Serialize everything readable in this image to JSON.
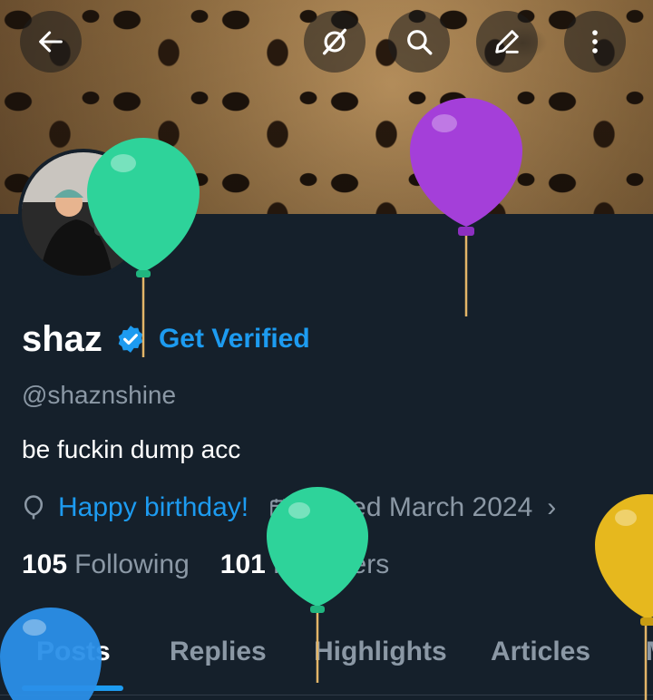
{
  "header": {
    "back_icon": "arrow-left-icon",
    "buttons": [
      {
        "name": "grok-icon"
      },
      {
        "name": "search-icon"
      },
      {
        "name": "compose-icon"
      },
      {
        "name": "more-vertical-icon"
      }
    ]
  },
  "profile": {
    "display_name": "shaz",
    "verified_icon": "verified-badge-icon",
    "get_verified_label": "Get Verified",
    "handle": "@shaznshine",
    "bio": "be fuckin dump acc",
    "birthday_label": "Happy birthday!",
    "joined_label": "Joined March 2024",
    "following_count": "105",
    "following_label": "Following",
    "followers_count": "101",
    "followers_label": "Followers"
  },
  "tabs": [
    {
      "label": "Posts",
      "active": true
    },
    {
      "label": "Replies"
    },
    {
      "label": "Highlights"
    },
    {
      "label": "Articles"
    }
  ],
  "colors": {
    "accent": "#1d9bf0",
    "background": "#15202b",
    "muted_text": "#8b98a5",
    "balloon_green": "#2ed39a",
    "balloon_purple": "#a43fd9",
    "balloon_blue": "#2a8fe8",
    "balloon_yellow": "#e6b81e"
  }
}
